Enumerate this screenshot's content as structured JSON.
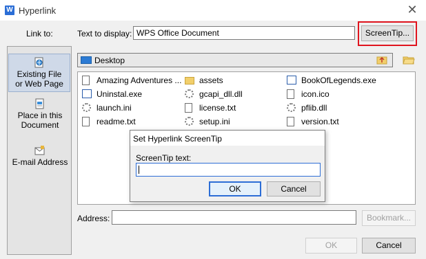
{
  "window": {
    "title": "Hyperlink",
    "app_icon_letter": "W",
    "close_glyph": "✕"
  },
  "link_to": {
    "label": "Link to:",
    "items": [
      {
        "label": "Existing File or Web Page",
        "label_lines": [
          "Existing File",
          "or Web Page"
        ],
        "icon": "globe-file-icon",
        "selected": true
      },
      {
        "label": "Place in this Document",
        "label_lines": [
          "Place in this",
          "Document"
        ],
        "icon": "document-place-icon",
        "selected": false
      },
      {
        "label": "E-mail Address",
        "label_lines": [
          "E-mail Address"
        ],
        "icon": "email-icon",
        "selected": false
      }
    ]
  },
  "text_to_display": {
    "label": "Text to display:",
    "value": "WPS Office Document"
  },
  "screentip_button": {
    "label": "ScreenTip..."
  },
  "folder": {
    "current": "Desktop",
    "up_icon": "up-folder-icon",
    "browse_icon": "open-folder-icon"
  },
  "files": [
    {
      "name": "Amazing Adventures ...",
      "icon": "document-icon"
    },
    {
      "name": "assets",
      "icon": "folder-icon"
    },
    {
      "name": "BookOfLegends.exe",
      "icon": "app-icon"
    },
    {
      "name": "Uninstal.exe",
      "icon": "app-icon"
    },
    {
      "name": "gcapi_dll.dll",
      "icon": "gear-file-icon"
    },
    {
      "name": "icon.ico",
      "icon": "document-icon"
    },
    {
      "name": "launch.ini",
      "icon": "gear-file-icon"
    },
    {
      "name": "license.txt",
      "icon": "text-file-icon"
    },
    {
      "name": "pflib.dll",
      "icon": "gear-file-icon"
    },
    {
      "name": "readme.txt",
      "icon": "text-file-icon"
    },
    {
      "name": "setup.ini",
      "icon": "gear-file-icon"
    },
    {
      "name": "version.txt",
      "icon": "text-file-icon"
    }
  ],
  "address": {
    "label": "Address:",
    "value": ""
  },
  "bookmark_button": {
    "label": "Bookmark..."
  },
  "ok_button": {
    "label": "OK"
  },
  "cancel_button": {
    "label": "Cancel"
  },
  "screentip_dialog": {
    "title": "Set Hyperlink ScreenTip",
    "field_label": "ScreenTip text:",
    "value": "",
    "ok_label": "OK",
    "cancel_label": "Cancel"
  },
  "colors": {
    "highlight_border": "#e0141e",
    "accent": "#2c6dd6"
  }
}
